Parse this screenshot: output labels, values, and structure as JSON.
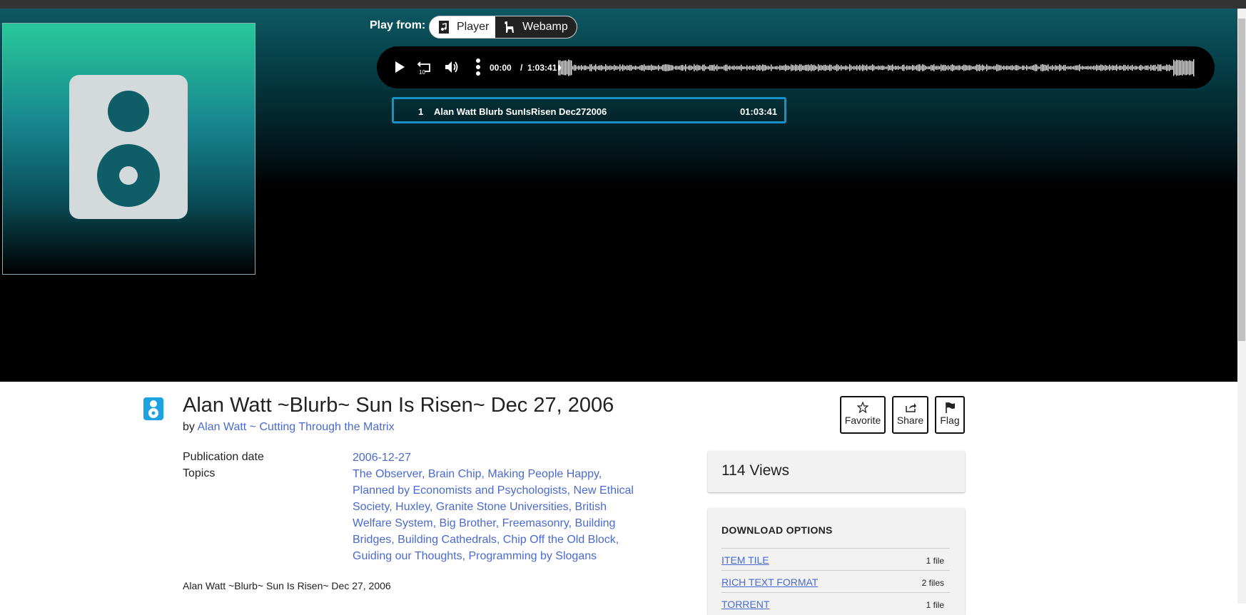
{
  "player": {
    "play_from_label": "Play from:",
    "options": [
      "Player",
      "Webamp"
    ],
    "current_time": "00:00",
    "separator": "/",
    "total_time": "1:03:41",
    "track": {
      "number": "1",
      "name": "Alan Watt Blurb SunIsRisen Dec272006",
      "duration": "01:03:41"
    }
  },
  "item": {
    "title": "Alan Watt ~Blurb~ Sun Is Risen~ Dec 27, 2006",
    "by_label": "by",
    "creator": "Alan Watt ~ Cutting Through the Matrix",
    "actions": [
      "Favorite",
      "Share",
      "Flag"
    ],
    "publication_date_label": "Publication date",
    "publication_date": "2006-12-27",
    "topics_label": "Topics",
    "topics": [
      "The Observer",
      "Brain Chip",
      "Making People Happy",
      "Planned by Economists and Psychologists",
      "New Ethical Society",
      "Huxley",
      "Granite Stone Universities",
      "British Welfare System",
      "Big Brother",
      "Freemasonry",
      "Building Bridges",
      "Building Cathedrals",
      "Chip Off the Old Block",
      "Guiding our Thoughts",
      "Programming by Slogans"
    ],
    "description": "Alan Watt ~Blurb~ Sun Is Risen~ Dec 27, 2006"
  },
  "sidebar": {
    "views": "114 Views",
    "download_header": "DOWNLOAD OPTIONS",
    "downloads": [
      {
        "format": "ITEM TILE",
        "count": "1 file"
      },
      {
        "format": "RICH TEXT FORMAT",
        "count": "2 files"
      },
      {
        "format": "TORRENT",
        "count": "1 file"
      }
    ]
  },
  "colors": {
    "accent": "#4b6acf",
    "track_border": "#1592c9",
    "icon_blue": "#1aa3e0"
  }
}
